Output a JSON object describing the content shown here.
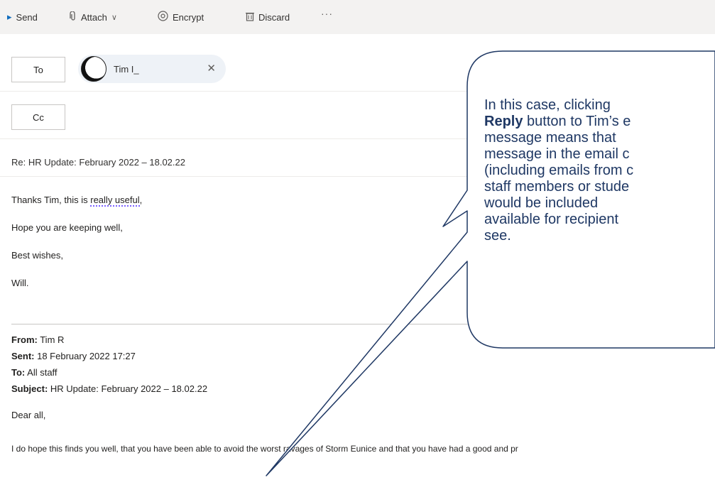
{
  "toolbar": {
    "send_label": "Send",
    "attach_label": "Attach",
    "encrypt_label": "Encrypt",
    "discard_label": "Discard",
    "more_label": "···"
  },
  "compose": {
    "to_label": "To",
    "cc_label": "Cc",
    "recipient_name": "Tim I_",
    "subject": "Re: HR Update: February 2022 – 18.02.22"
  },
  "body": {
    "line1_pre": "Thanks Tim, this is ",
    "line1_underlined": "really useful",
    "line1_post": ",",
    "line2": "Hope you are keeping well,",
    "line3": "Best wishes,",
    "line4": "Will."
  },
  "quoted": {
    "from_label": "From:",
    "from_value": " Tim R",
    "sent_label": "Sent:",
    "sent_value": " 18 February 2022 17:27",
    "to_label": "To:",
    "to_value": " All staff",
    "subject_label": "Subject:",
    "subject_value": " HR Update: February 2022 – 18.02.22",
    "greeting": "Dear all,",
    "paragraph": "I do hope this finds you well, that you have been able to avoid the worst ravages of Storm Eunice and that you have had a good and pr"
  },
  "callout": {
    "line1_pre": "In this case, clicking",
    "line2_bold": "Reply",
    "line2_post": " button to Tim’s e",
    "line3": "message means that",
    "line4": "message in the email c",
    "line5": "(including emails from c",
    "line6": "staff members or stude",
    "line7": "would be included",
    "line8": "available for recipient",
    "line9": "see."
  },
  "colors": {
    "accent": "#0f6cbd",
    "callout_border": "#1f3864",
    "callout_text": "#1f3864"
  },
  "icons": {
    "send": "send-icon",
    "attach": "paperclip-icon",
    "encrypt": "encrypt-icon",
    "discard": "trash-icon",
    "close": "close-icon"
  }
}
